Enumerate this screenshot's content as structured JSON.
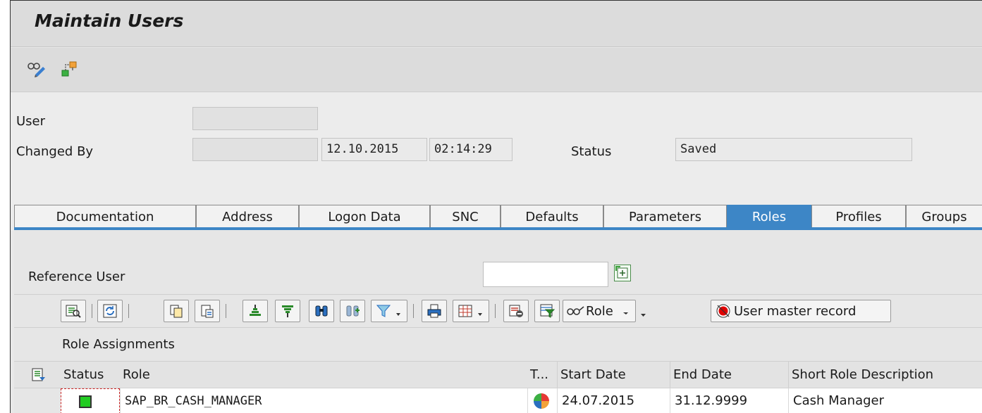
{
  "window": {
    "title": "Maintain Users"
  },
  "toolbar": {
    "icons": [
      "display-change-icon",
      "org-structure-icon"
    ]
  },
  "header": {
    "user_label": "User",
    "user_value": "",
    "changed_by_label": "Changed By",
    "changed_by_value": "",
    "changed_date": "12.10.2015",
    "changed_time": "02:14:29",
    "status_label": "Status",
    "status_value": "Saved"
  },
  "tabs": [
    {
      "label": "Documentation",
      "active": false
    },
    {
      "label": "Address",
      "active": false
    },
    {
      "label": "Logon Data",
      "active": false
    },
    {
      "label": "SNC",
      "active": false
    },
    {
      "label": "Defaults",
      "active": false
    },
    {
      "label": "Parameters",
      "active": false
    },
    {
      "label": "Roles",
      "active": true
    },
    {
      "label": "Profiles",
      "active": false
    },
    {
      "label": "Groups",
      "active": false
    }
  ],
  "roles": {
    "reference_user_label": "Reference User",
    "reference_user_value": "",
    "toolbar": {
      "role_button_label": "Role",
      "user_master_record_label": "User master record"
    },
    "section_title": "Role Assignments",
    "columns": {
      "status": "Status",
      "role": "Role",
      "type": "T...",
      "start_date": "Start Date",
      "end_date": "End Date",
      "description": "Short Role Description"
    },
    "rows": [
      {
        "status_color": "#22cc22",
        "role": "SAP_BR_CASH_MANAGER",
        "start_date": "24.07.2015",
        "end_date": "31.12.9999",
        "description": "Cash Manager"
      }
    ]
  },
  "colors": {
    "active_tab": "#3d86c6",
    "status_green": "#22cc22",
    "alert_red": "#e00000"
  }
}
